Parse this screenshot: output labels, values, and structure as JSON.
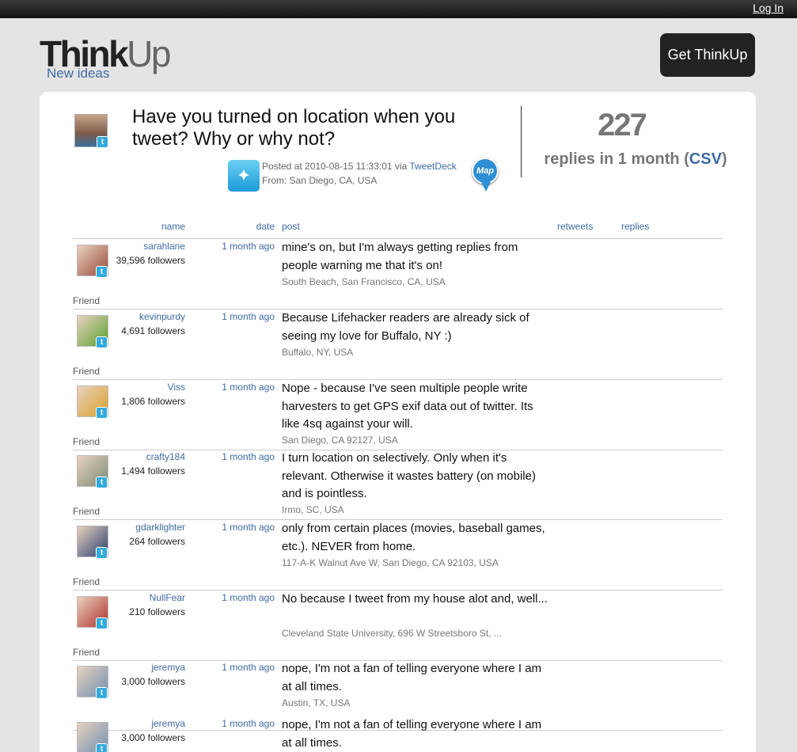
{
  "topbar": {
    "login_label": "Log In"
  },
  "brand": {
    "logo_think": "Think",
    "logo_up": "Up",
    "tagline": "New ideas",
    "get_button": "Get ThinkUp"
  },
  "original_post": {
    "text": "Have you turned on location when you tweet? Why or why not?",
    "posted_prefix": "Posted at 2010-08-15 11:33:01 via ",
    "client": "TweetDeck",
    "from": "From: San Diego, CA, USA",
    "map_label": "Map"
  },
  "stats": {
    "count": "227",
    "label": "replies in 1 month (",
    "csv": "CSV",
    "label_end": ")"
  },
  "table": {
    "headers": {
      "name": "name",
      "date": "date",
      "post": "post",
      "retweets": "retweets",
      "replies": "replies"
    },
    "rows": [
      {
        "user": "sarahlane",
        "followers": "39,596 followers",
        "date": "1 month ago",
        "post": "mine's on, but I'm always getting replies from people warning me that it's on!",
        "location": "South Beach, San Francisco, CA, USA",
        "friend": "Friend",
        "avatar_color": "#9b4a3c"
      },
      {
        "user": "kevinpurdy",
        "followers": "4,691 followers",
        "date": "1 month ago",
        "post": "Because Lifehacker readers are already sick of seeing my love for Buffalo, NY :)",
        "location": "Buffalo, NY, USA",
        "friend": "Friend",
        "avatar_color": "#5aa02c"
      },
      {
        "user": "Viss",
        "followers": "1,806 followers",
        "date": "1 month ago",
        "post": "Nope - because I've seen multiple people write harvesters to get GPS exif data out of twitter. Its like 4sq against your will.",
        "location": "San Diego, CA 92127, USA",
        "friend": "Friend",
        "avatar_color": "#d9a12a"
      },
      {
        "user": "crafty184",
        "followers": "1,494 followers",
        "date": "1 month ago",
        "post": "I turn location on selectively. Only when it's relevant. Otherwise it wastes battery (on mobile) and is pointless.",
        "location": "Irmo, SC, USA",
        "friend": "Friend",
        "avatar_color": "#7c8a74"
      },
      {
        "user": "gdarklighter",
        "followers": "264 followers",
        "date": "1 month ago",
        "post": "only from certain places (movies, baseball games, etc.). NEVER from home.",
        "location": "117-A-K Walnut Ave W, San Diego, CA 92103, USA",
        "friend": "Friend",
        "avatar_color": "#2b3f6e"
      },
      {
        "user": "NullFear",
        "followers": "210 followers",
        "date": "1 month ago",
        "post": "No because I tweet from my house alot and, well...",
        "location": "Cleveland State University, 696 W Streetsboro St, ...",
        "friend": "Friend",
        "avatar_color": "#b0302a"
      },
      {
        "user": "jeremya",
        "followers": "3,000 followers",
        "date": "1 month ago",
        "post": "nope, I'm not a fan of telling everyone where I am at all times.",
        "location": "Austin, TX, USA",
        "friend": "",
        "avatar_color": "#6f8fb0"
      },
      {
        "user": "jeremya",
        "followers": "3,000 followers",
        "date": "1 month ago",
        "post": "nope, I'm not a fan of telling everyone where I am at all times.",
        "location": "",
        "friend": "",
        "avatar_color": "#6f8fb0"
      }
    ]
  }
}
